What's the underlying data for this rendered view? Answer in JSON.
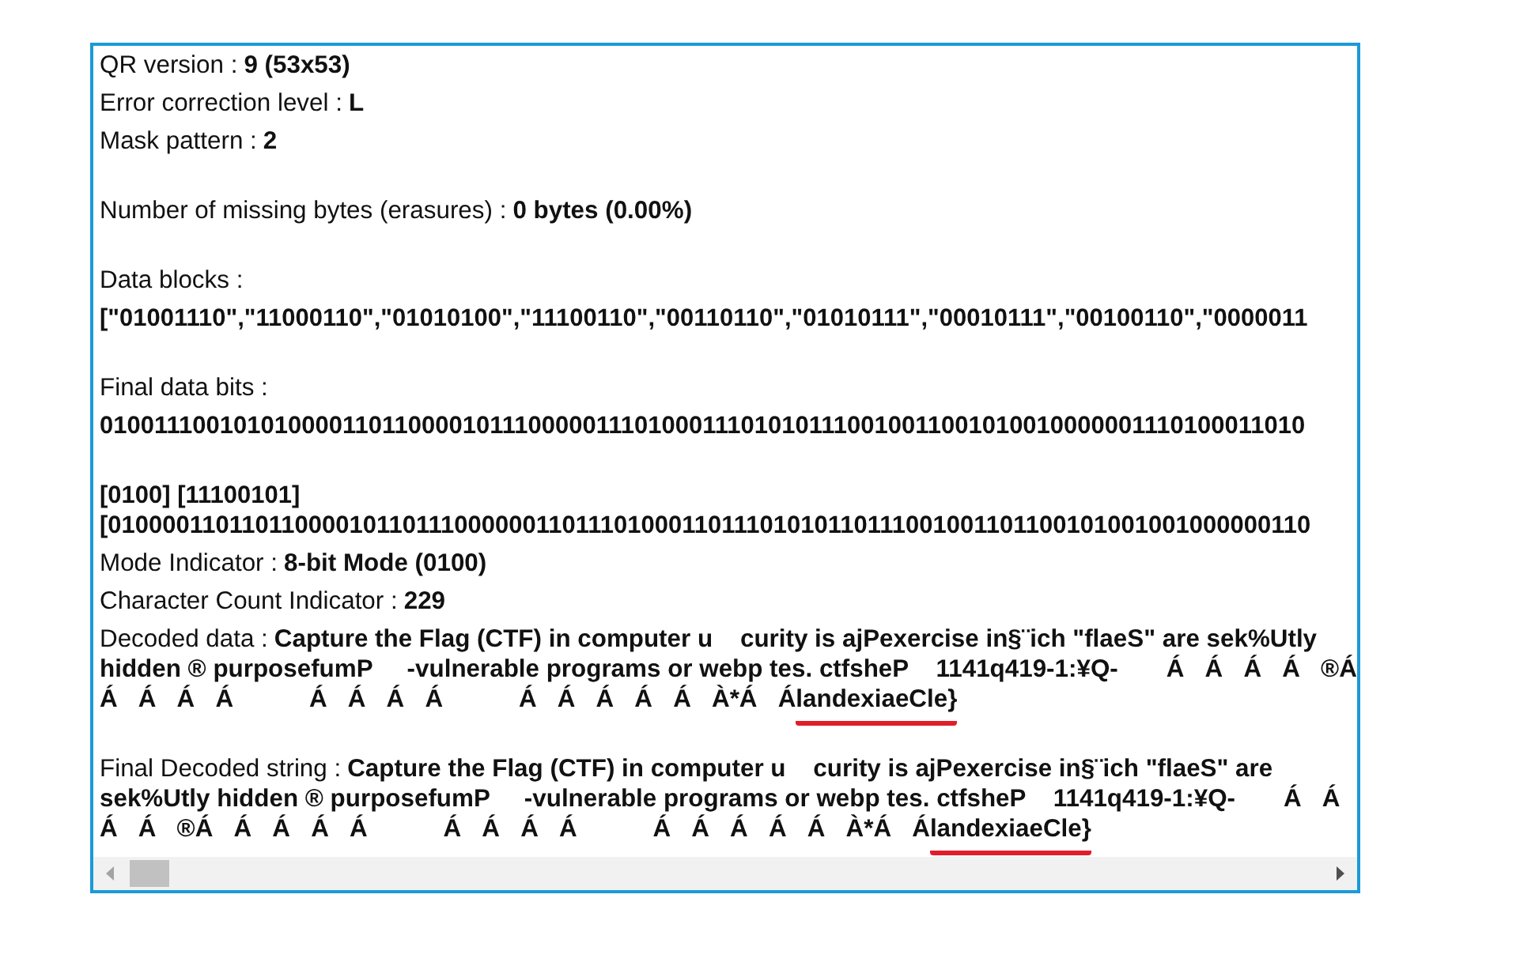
{
  "sections": [
    {
      "rows": [
        {
          "kind": "inline",
          "label": "QR version :",
          "value": "9 (53x53)"
        },
        {
          "kind": "inline",
          "label": "Error correction level :",
          "value": "L"
        },
        {
          "kind": "inline",
          "label": "Mask pattern :",
          "value": "2"
        }
      ]
    },
    {
      "rows": [
        {
          "kind": "inline",
          "label": "Number of missing bytes (erasures) :",
          "value": "0 bytes (0.00%)"
        }
      ]
    },
    {
      "rows": [
        {
          "kind": "stacked",
          "label": "Data blocks :",
          "value": "[\"01001110\",\"11000110\",\"01010100\",\"11100110\",\"00110110\",\"01010111\",\"00010111\",\"00100110\",\"0000011"
        }
      ]
    },
    {
      "rows": [
        {
          "kind": "stacked",
          "label": "Final data bits :",
          "value": "010011100101010000110110000101110000011101000111010101110010011001010010000001110100011010"
        }
      ]
    },
    {
      "rows": [
        {
          "kind": "bits",
          "lines": [
            "[0100] [11100101]",
            "[010000110110110000101101110000001101110100011011101010110111001001101100101001001000000110"
          ]
        },
        {
          "kind": "inline",
          "label": "Mode Indicator :",
          "value": "8-bit Mode (0100)"
        },
        {
          "kind": "inline",
          "label": "Character Count Indicator :",
          "value": "229"
        },
        {
          "kind": "paragraph",
          "label": "Decoded data :",
          "value": "Capture the Flag (CTF) in computer u    curity is ajPexercise in§¨ich \"flaeS\" are sek%Utly hidden ® purposefumP     -vulnerable programs or webp tes. ctfsheP    1141q419-1:¥Q-       Á   Á   Á   Á   ®Á   Á   Á   Á   Á           Á   Á   Á   Á           Á   Á   Á   Á   Á   À*Á   Á",
          "underlined": "landexiaeCle}"
        }
      ]
    },
    {
      "rows": [
        {
          "kind": "paragraph",
          "label": "Final Decoded string :",
          "value": "Capture the Flag (CTF) in computer u    curity is ajPexercise in§¨ich \"flaeS\" are sek%Utly hidden ® purposefumP     -vulnerable programs or webp tes. ctfsheP    1141q419-1:¥Q-       Á   Á   Á   Á   ®Á   Á   Á   Á   Á           Á   Á   Á   Á           Á   Á   Á   Á   Á   À*Á   Á",
          "underlined": "landexiaeCle}"
        }
      ]
    }
  ]
}
